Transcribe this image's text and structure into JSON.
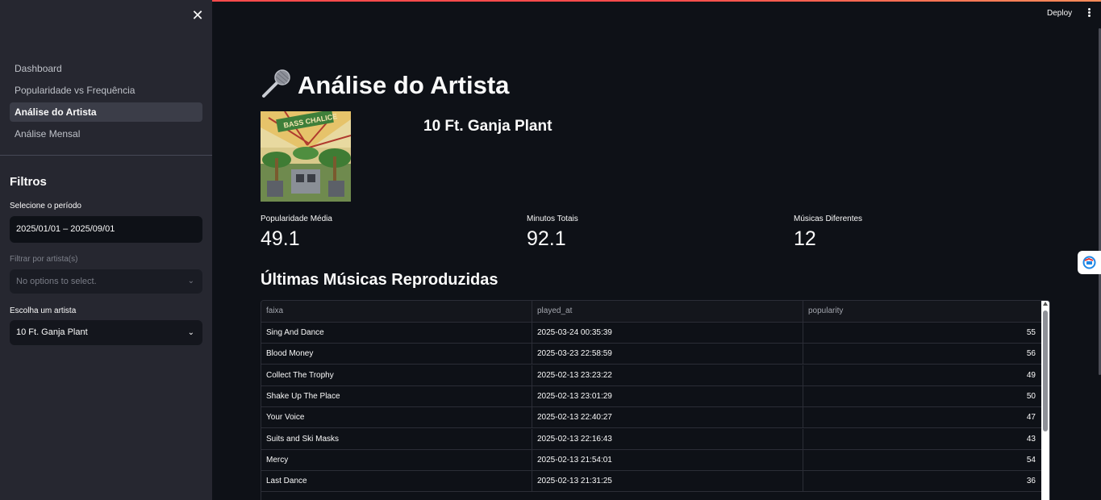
{
  "sidebar": {
    "nav": [
      {
        "label": "Dashboard",
        "active": false
      },
      {
        "label": "Popularidade vs Frequência",
        "active": false
      },
      {
        "label": "Análise do Artista",
        "active": true
      },
      {
        "label": "Análise Mensal",
        "active": false
      }
    ],
    "filters_title": "Filtros",
    "period_label": "Selecione o período",
    "period_value": "2025/01/01 – 2025/09/01",
    "artist_filter_label": "Filtrar por artista(s)",
    "artist_filter_placeholder": "No options to select.",
    "choose_artist_label": "Escolha um artista",
    "choose_artist_value": "10 Ft. Ganja Plant"
  },
  "header": {
    "deploy_label": "Deploy"
  },
  "main": {
    "title": "Análise do Artista",
    "title_icon": "microphone-icon",
    "artist_name": "10 Ft. Ganja Plant",
    "metrics": [
      {
        "label": "Popularidade Média",
        "value": "49.1"
      },
      {
        "label": "Minutos Totais",
        "value": "92.1"
      },
      {
        "label": "Músicas Diferentes",
        "value": "12"
      }
    ],
    "recent_title": "Últimas Músicas Reproduzidas",
    "table": {
      "columns": [
        "faixa",
        "played_at",
        "popularity"
      ],
      "rows": [
        [
          "Sing And Dance",
          "2025-03-24 00:35:39",
          "55"
        ],
        [
          "Blood Money",
          "2025-03-23 22:58:59",
          "56"
        ],
        [
          "Collect The Trophy",
          "2025-02-13 23:23:22",
          "49"
        ],
        [
          "Shake Up The Place",
          "2025-02-13 23:01:29",
          "50"
        ],
        [
          "Your Voice",
          "2025-02-13 22:40:27",
          "47"
        ],
        [
          "Suits and Ski Masks",
          "2025-02-13 22:16:43",
          "43"
        ],
        [
          "Mercy",
          "2025-02-13 21:54:01",
          "54"
        ],
        [
          "Last Dance",
          "2025-02-13 21:31:25",
          "36"
        ]
      ]
    }
  },
  "colors": {
    "background": "#0e1117",
    "sidebar": "#262730",
    "accent": "#ff4b4b"
  }
}
